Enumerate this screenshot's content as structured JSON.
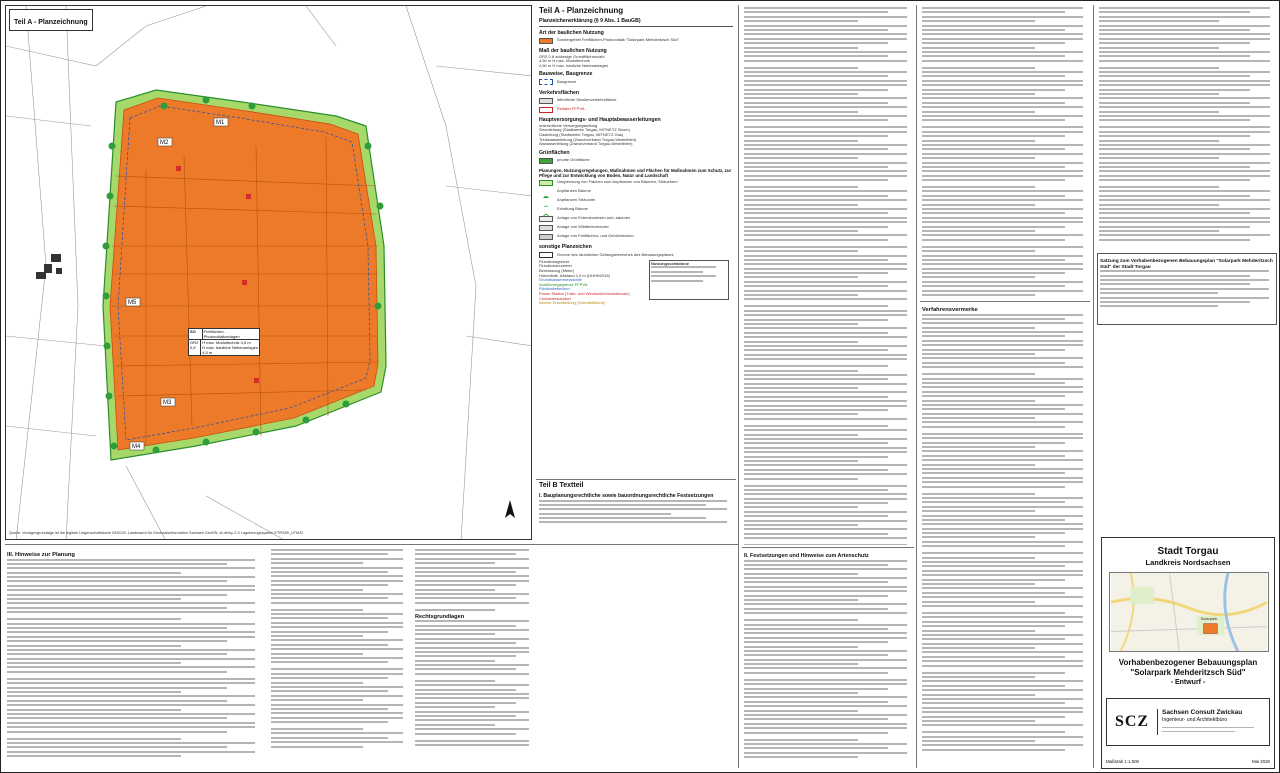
{
  "plan_part_a": {
    "label": "Teil A - Planzeichnung",
    "source_note": "Quelle: Vorlagengrundlage ist die digitale Liegenschaftskarte 03/2025, Landesamt für Geobasisinformation Sachsen GeoSN, dl-de/by-2-0 Lagebezugssystem ETRS89_UTM33",
    "fill_color": "#ec7a28",
    "table": {
      "title": "SO",
      "subtitle": "Freiflächen-Photovoltaikanlagen",
      "grz_label": "GRZ 0,8",
      "row1": "H max. Modultechnik 4,5 m",
      "row2": "H max. bauliche Nebenanlagen 4,5 m"
    },
    "markers": [
      "M1",
      "M2",
      "M3",
      "M4",
      "M5"
    ]
  },
  "legend": {
    "title": "Teil A - Planzeichnung",
    "subtitle": "Planzeichenerklärung (§ 9 Abs. 1 BauGB)",
    "sec1": "Art der baulichen Nutzung",
    "sec1_item": "Sondergebiet Freiflächen-Photovoltaik \"Solarpark Mehderitzsch Süd\"",
    "sec2": "Maß der baulichen Nutzung",
    "sec2_items": [
      "GRZ 0,8  zulässige Grundflächenzahl",
      "4,50 m  H max. Modultechnik",
      "4,50 m  H max. bauliche Nebenanlagen"
    ],
    "sec3": "Bauweise, Baugrenze",
    "sec3_item": "Baugrenze",
    "sec4": "Verkehrsflächen",
    "sec4_items": [
      "öffentliche Straßenverkehrsfläche",
      "Einfahrt FFPVA"
    ],
    "sec5": "Hauptversorgungs- und Hauptabwasserleitungen",
    "sec5_items": [
      "unterirdische Versorgungsleitung",
      "Stromleitung (Stadtwerke Torgau, MITNETZ Strom)",
      "Gasleitung (Stadtwerke Torgau, MITNETZ Gas)",
      "Trinkwasserleitung (Zweckverband Torgau-Westelbien)",
      "Abwasserleitung (Zweckverband Torgau-Westelbien)"
    ],
    "sec6": "Grünflächen",
    "sec6_item": "private Grünfläche",
    "sec7": "Planungen, Nutzungsregelungen, Maßnahmen und Flächen für Maßnahmen zum Schutz, zur Pflege und zur Entwicklung von Boden, Natur und Landschaft",
    "sec7_items": [
      "Umgrenzung von Flächen zum Anpflanzen von Bäumen, Sträuchern",
      "Anpflanzen Bäume",
      "Anpflanzen Sträucher",
      "Erhaltung Bäume",
      "Anlage von Extensivwiesen und -säumen",
      "Anlage von Wildtierkorridoren",
      "Anlage von Freiflächen- und Gehölzhecken"
    ],
    "sec8": "sonstige Planzeichen",
    "sec8_items": [
      "Grenze des räumlichen Geltungsbereiches des Bebauungsplanes",
      "Flurstücksgrenze",
      "Flurstücksnummer",
      "Bemassung (Meter)",
      "Höhenlinie, Abstand 1,0 m (DHHN2016)",
      "Grundwassermessstelle",
      "Ausführungsgrenze FFPVA",
      "Rückhaltebecken",
      "Power Station (Trafo- und Wechselrichterstationen)",
      "Containerstandort",
      "Interne Erschließung (Schotterfläche)"
    ],
    "nutzung_title": "Nutzungsschablone",
    "teil_b_title": "Teil B Textteil",
    "teil_b_sub": "I. Bauplanungsrechtliche sowie bauordnungsrechtliche Festsetzungen"
  },
  "hinweise": {
    "title": "III. Hinweise zur Planung"
  },
  "rechtsgrundlagen": {
    "title": "Rechtsgrundlagen"
  },
  "festsetzungen": {
    "title": "II. Festsetzungen und Hinweise zum Artenschutz"
  },
  "verfahren": {
    "title": "Verfahrensvermerke",
    "sig_labels": [
      "Datum",
      "Siegel",
      "Bürgermeister"
    ]
  },
  "satzung": {
    "title": "Satzung zum Vorhabenbezogenen Bebauungsplan \"Solarpark Mehderitzsch Süd\" der Stadt Torgau"
  },
  "title_block": {
    "city": "Stadt Torgau",
    "county": "Landkreis Nordsachsen",
    "plan_title": "Vorhabenbezogener Bebauungsplan",
    "plan_name": "\"Solarpark Mehderitzsch Süd\"",
    "status": "- Entwurf -",
    "firm_logo": "SCZ",
    "firm_line1": "Sachsen Consult Zwickau",
    "firm_line2": "Ingenieur- und Architektbüro",
    "scale": "Maßstab 1:1.500",
    "date": "Mai 2026",
    "map_label": "Solarpark"
  },
  "colors": {
    "orange": "#ec7a28",
    "green": "#3aa63a",
    "lightgreen": "#a6d96a",
    "red": "#d62b2b",
    "blue": "#2563c7"
  }
}
